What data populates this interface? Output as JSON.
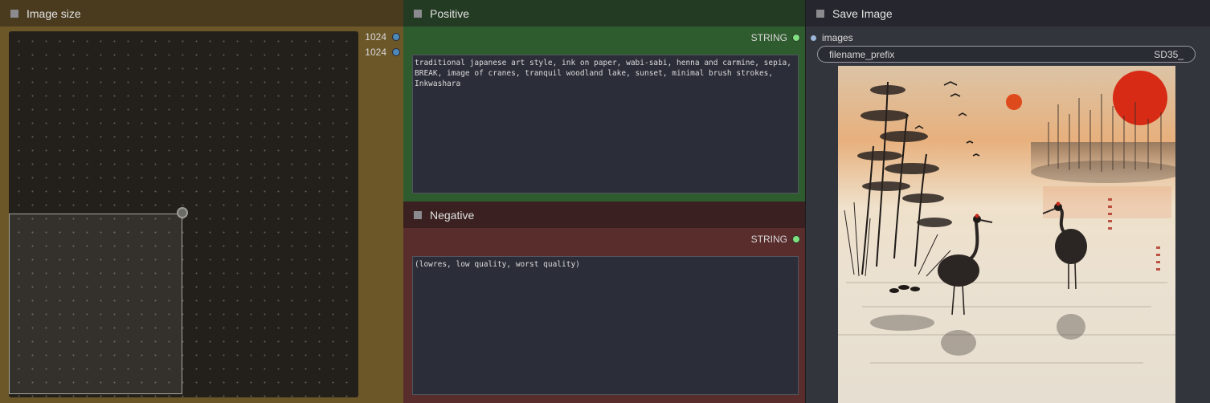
{
  "image_size": {
    "title": "Image size",
    "outputs": [
      "1024",
      "1024"
    ]
  },
  "positive": {
    "title": "Positive",
    "output_type": "STRING",
    "text": "traditional japanese art style, ink on paper, wabi-sabi, henna and carmine, sepia,\nBREAK, image of cranes, tranquil woodland lake, sunset, minimal brush strokes,\nInkwashara"
  },
  "negative": {
    "title": "Negative",
    "output_type": "STRING",
    "text": "(lowres, low quality, worst quality)"
  },
  "save_image": {
    "title": "Save Image",
    "input_label": "images",
    "widget": {
      "name": "filename_prefix",
      "value": "SD35_"
    }
  },
  "colors": {
    "image_size_body": "#6c5728",
    "positive_body": "#2f5c2f",
    "negative_body": "#5a2d2d",
    "save_body": "#33353c",
    "output_socket": "#4d88b8",
    "string_socket": "#7fe07f"
  }
}
